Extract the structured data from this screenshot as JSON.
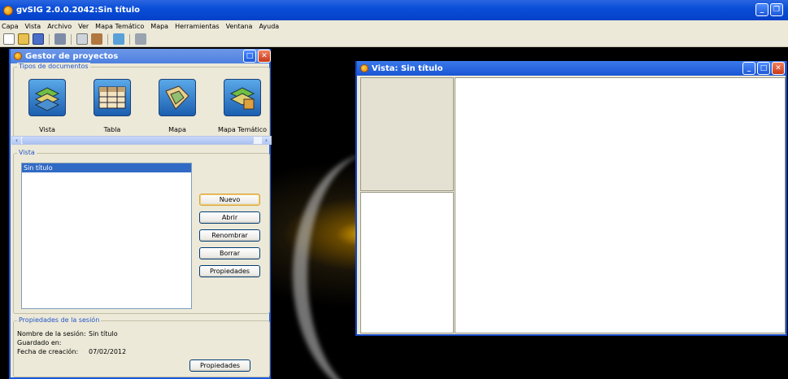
{
  "app": {
    "title": "gvSIG 2.0.0.2042:Sin título"
  },
  "menu": [
    "Capa",
    "Vista",
    "Archivo",
    "Ver",
    "Mapa Temático",
    "Mapa",
    "Herramientas",
    "Ventana",
    "Ayuda"
  ],
  "project_manager": {
    "title": "Gestor de proyectos",
    "doc_types_label": "Tipos de documentos",
    "doc_types": [
      {
        "label": "Vista",
        "icon": "vista-doc-icon"
      },
      {
        "label": "Tabla",
        "icon": "table-doc-icon"
      },
      {
        "label": "Mapa",
        "icon": "map-doc-icon"
      },
      {
        "label": "Mapa Temático",
        "icon": "thematic-map-doc-icon"
      }
    ],
    "vista_group_label": "Vista",
    "vista_items": [
      "Sin título"
    ],
    "buttons": {
      "new": "Nuevo",
      "open": "Abrir",
      "rename": "Renombrar",
      "delete": "Borrar",
      "properties": "Propiedades"
    },
    "session": {
      "label": "Propiedades de la sesión",
      "name_label": "Nombre de la sesión:",
      "name_value": "Sin título",
      "saved_label": "Guardado en:",
      "saved_value": "",
      "created_label": "Fecha de creación:",
      "created_value": "07/02/2012",
      "properties_button": "Propiedades"
    }
  },
  "vista_window": {
    "title": "Vista: Sin título"
  },
  "colors": {
    "titlebar": "#0a4ed8",
    "selection": "#316ac5",
    "window_bg": "#ece9d8"
  }
}
